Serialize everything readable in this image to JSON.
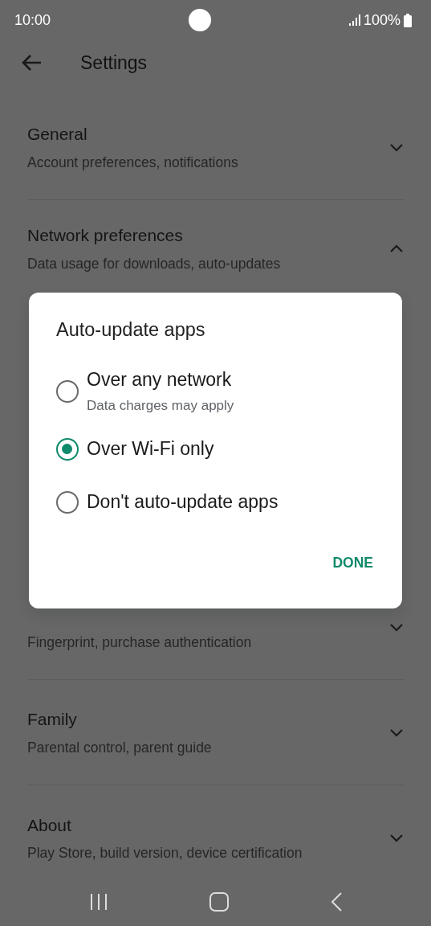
{
  "status_bar": {
    "time": "10:00",
    "battery": "100%"
  },
  "app_bar": {
    "title": "Settings"
  },
  "sections": [
    {
      "title": "General",
      "subtitle": "Account preferences, notifications",
      "expanded": false
    },
    {
      "title": "Network preferences",
      "subtitle": "Data usage for downloads, auto-updates",
      "expanded": true
    },
    {
      "subtitle": "Fingerprint, purchase authentication",
      "expanded": false
    },
    {
      "title": "Family",
      "subtitle": "Parental control, parent guide",
      "expanded": false
    },
    {
      "title": "About",
      "subtitle": "Play Store, build version, device certification",
      "expanded": false
    }
  ],
  "dialog": {
    "title": "Auto-update apps",
    "options": [
      {
        "label": "Over any network",
        "subtitle": "Data charges may apply",
        "selected": false
      },
      {
        "label": "Over Wi-Fi only",
        "selected": true
      },
      {
        "label": "Don't auto-update apps",
        "selected": false
      }
    ],
    "button": "DONE"
  }
}
